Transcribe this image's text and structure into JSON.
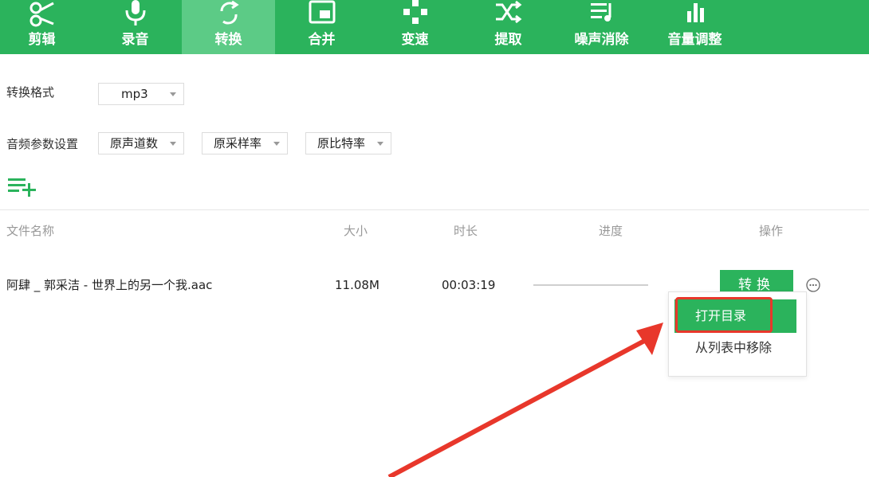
{
  "toolbar": {
    "items": [
      {
        "label": "剪辑",
        "icon": "scissors-icon"
      },
      {
        "label": "录音",
        "icon": "microphone-icon"
      },
      {
        "label": "转换",
        "icon": "convert-icon",
        "active": true
      },
      {
        "label": "合并",
        "icon": "merge-icon"
      },
      {
        "label": "变速",
        "icon": "speed-icon"
      },
      {
        "label": "提取",
        "icon": "extract-icon"
      },
      {
        "label": "噪声消除",
        "icon": "noise-removal-icon"
      },
      {
        "label": "音量调整",
        "icon": "volume-bars-icon"
      }
    ]
  },
  "settings": {
    "format_label": "转换格式",
    "format_value": "mp3",
    "audio_params_label": "音频参数设置",
    "channels_value": "原声道数",
    "sample_rate_value": "原采样率",
    "bitrate_value": "原比特率"
  },
  "table": {
    "headers": {
      "name": "文件名称",
      "size": "大小",
      "duration": "时长",
      "progress": "进度",
      "action": "操作"
    },
    "rows": [
      {
        "name": "阿肆 _ 郭采洁 - 世界上的另一个我.aac",
        "size": "11.08M",
        "duration": "00:03:19",
        "progress": 0,
        "button": "转换"
      }
    ]
  },
  "context_menu": {
    "open_folder": "打开目录",
    "remove": "从列表中移除"
  },
  "colors": {
    "brand": "#2bb35c",
    "active_tab": "#5ccb86",
    "highlight": "#e8372b"
  }
}
